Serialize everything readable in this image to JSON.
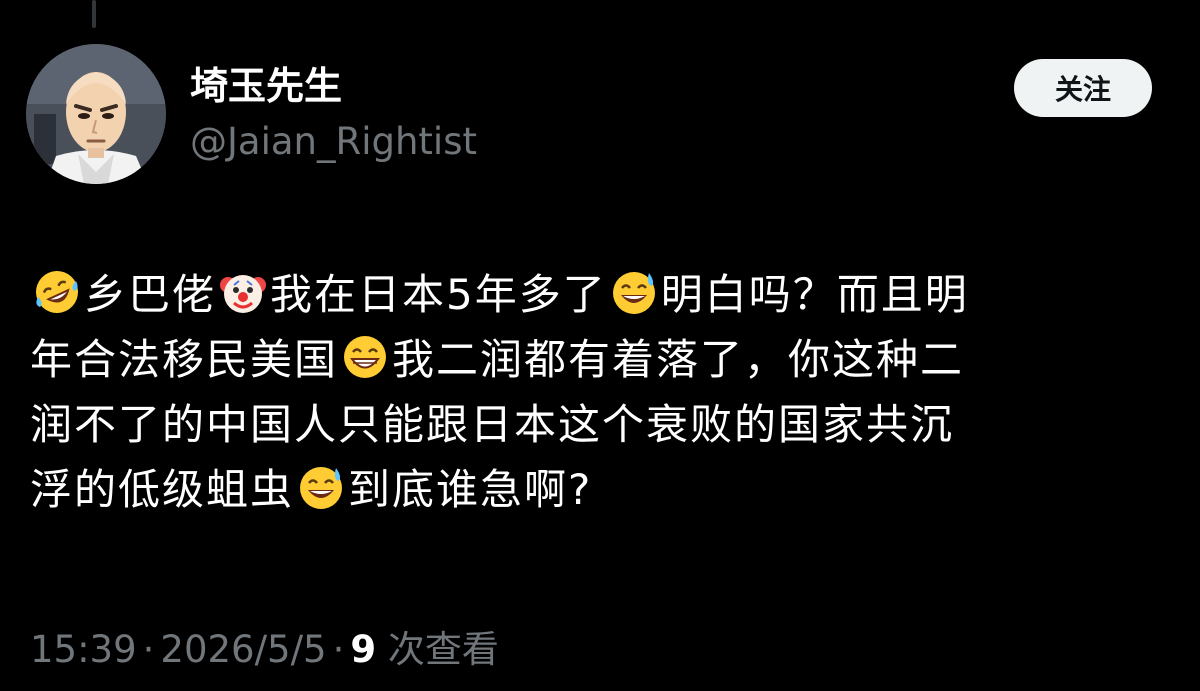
{
  "author": {
    "display_name": "埼玉先生",
    "handle": "@Jaian_Rightist",
    "avatar_icon": "anime-bald-hero-avatar"
  },
  "follow_button": {
    "label": "关注"
  },
  "tweet": {
    "segments": {
      "s1": "乡巴佬",
      "s2": "我在日本5年多了",
      "s3": "明白吗？而且明",
      "s4": "年合法移民美国",
      "s5": "我二润都有着落了，你这种二",
      "s6": "润不了的中国人只能跟日本这个衰败的国家共沉",
      "s7": "浮的低级蛆虫",
      "s8": "到底谁急啊?"
    },
    "emojis": [
      "rofl-emoji",
      "clown-face-emoji",
      "grinning-sweat-emoji",
      "beaming-smile-emoji",
      "grinning-sweat-emoji"
    ]
  },
  "meta": {
    "time": "15:39",
    "date": "2026/5/5",
    "views_count": "9",
    "views_label": "次查看",
    "separator": "·"
  },
  "colors": {
    "background": "#000000",
    "primary_text": "#ffffff",
    "secondary_text": "#71767b",
    "follow_bg": "#eff3f4"
  }
}
